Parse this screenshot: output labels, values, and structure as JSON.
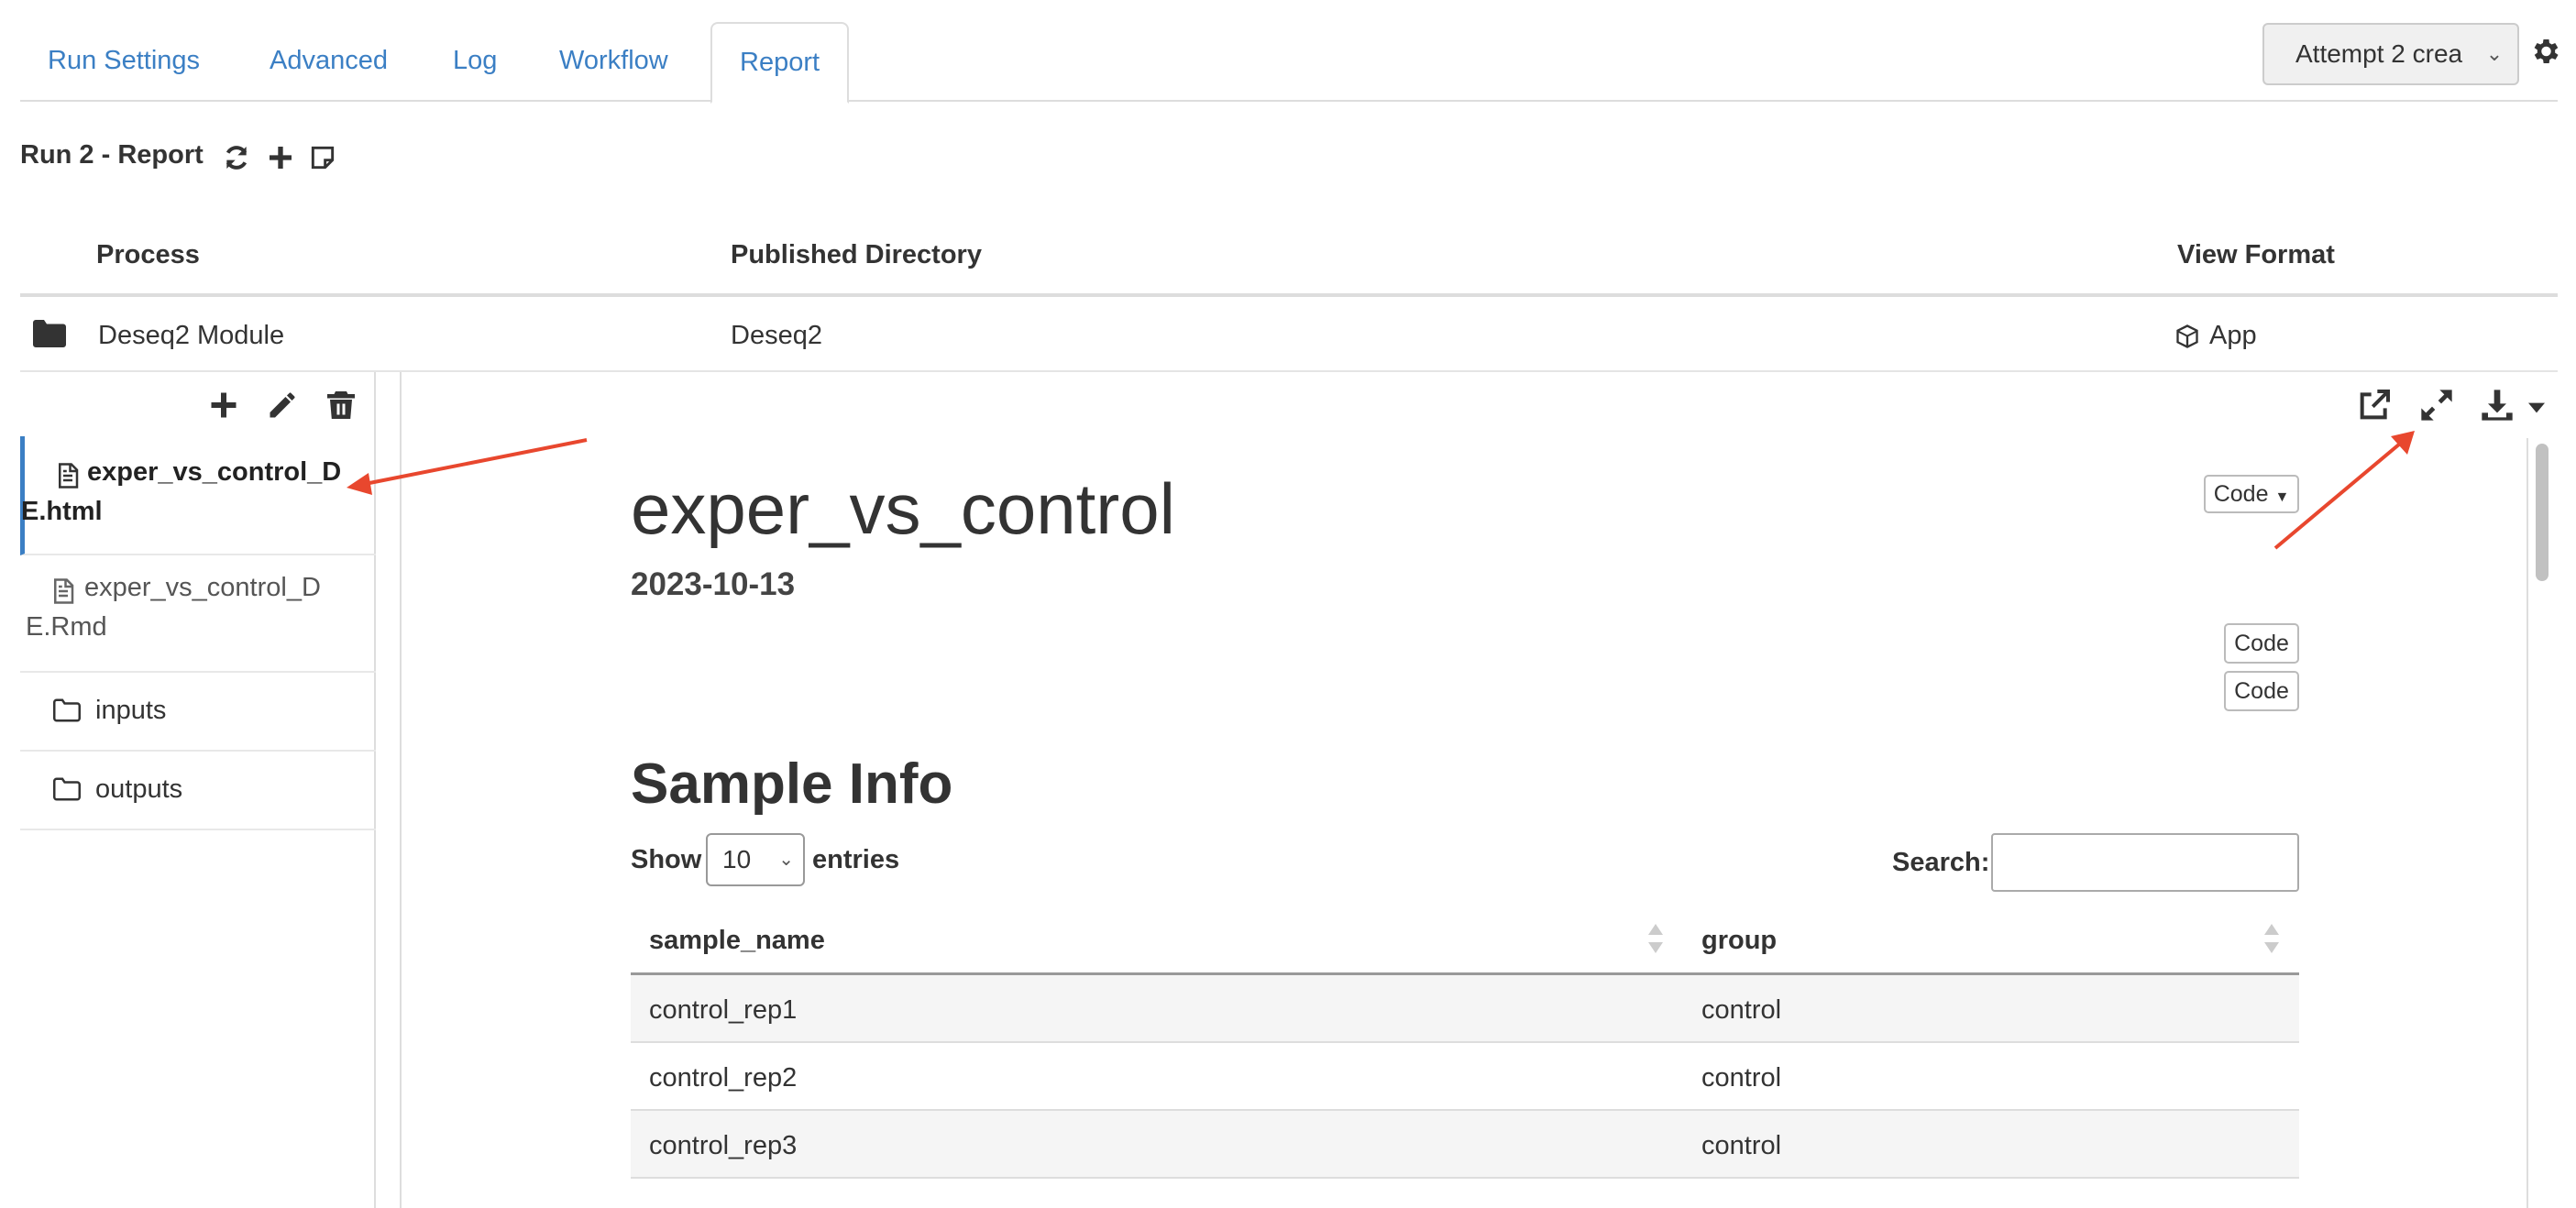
{
  "tabs": [
    {
      "label": "Run Settings"
    },
    {
      "label": "Advanced"
    },
    {
      "label": "Log"
    },
    {
      "label": "Workflow"
    },
    {
      "label": "Report",
      "active": true
    }
  ],
  "attempt_select": {
    "value": "Attempt 2 crea"
  },
  "header": {
    "title": "Run 2 - Report"
  },
  "report_table": {
    "columns": [
      "Process",
      "Published Directory",
      "View Format"
    ],
    "row": {
      "process": "Deseq2 Module",
      "directory": "Deseq2",
      "view_format": "App"
    }
  },
  "files": [
    {
      "name": "exper_vs_control_DE.html",
      "line1": "exper_vs_control_D",
      "line2": "E.html",
      "type": "file",
      "active": true
    },
    {
      "name": "exper_vs_control_DE.Rmd",
      "line1": "exper_vs_control_D",
      "line2": "E.Rmd",
      "type": "file"
    },
    {
      "name": "inputs",
      "line1": "inputs",
      "type": "folder"
    },
    {
      "name": "outputs",
      "line1": "outputs",
      "type": "folder"
    }
  ],
  "document": {
    "title": "exper_vs_control",
    "date": "2023-10-13",
    "code_dropdown": "Code",
    "code_buttons": [
      "Code",
      "Code"
    ],
    "section_title": "Sample Info",
    "show_label": "Show",
    "entries_label": "entries",
    "page_length": "10",
    "search_label": "Search:",
    "search_value": "",
    "table": {
      "columns": [
        "sample_name",
        "group"
      ],
      "rows": [
        [
          "control_rep1",
          "control"
        ],
        [
          "control_rep2",
          "control"
        ],
        [
          "control_rep3",
          "control"
        ]
      ]
    }
  },
  "annotation_color": "#e8472e",
  "accent_color": "#3b7fc4"
}
